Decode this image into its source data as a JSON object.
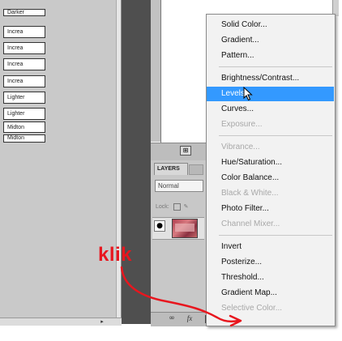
{
  "actions": {
    "rows": [
      "Darker",
      "Increa",
      "Increa",
      "Increa",
      "Increa",
      "Lighter",
      "Lighter",
      "Midton",
      "Midton"
    ]
  },
  "layers_panel": {
    "tab_label": "LAYERS",
    "blend_mode": "Normal",
    "lock_label": "Lock:"
  },
  "menu": {
    "items": [
      {
        "label": "Solid Color...",
        "state": "enabled"
      },
      {
        "label": "Gradient...",
        "state": "enabled"
      },
      {
        "label": "Pattern...",
        "state": "enabled"
      },
      {
        "label": "Brightness/Contrast...",
        "state": "enabled"
      },
      {
        "label": "Levels...",
        "state": "highlighted"
      },
      {
        "label": "Curves...",
        "state": "enabled"
      },
      {
        "label": "Exposure...",
        "state": "disabled"
      },
      {
        "label": "Vibrance...",
        "state": "disabled"
      },
      {
        "label": "Hue/Saturation...",
        "state": "enabled"
      },
      {
        "label": "Color Balance...",
        "state": "enabled"
      },
      {
        "label": "Black & White...",
        "state": "disabled"
      },
      {
        "label": "Photo Filter...",
        "state": "enabled"
      },
      {
        "label": "Channel Mixer...",
        "state": "disabled"
      },
      {
        "label": "Invert",
        "state": "enabled"
      },
      {
        "label": "Posterize...",
        "state": "enabled"
      },
      {
        "label": "Threshold...",
        "state": "enabled"
      },
      {
        "label": "Gradient Map...",
        "state": "enabled"
      },
      {
        "label": "Selective Color...",
        "state": "disabled"
      }
    ],
    "highlight_color": "#3399ff",
    "disabled_color": "#a8a8a8"
  },
  "annotation": {
    "label": "klik",
    "color": "#e8161e"
  },
  "icons": {
    "link": "link-icon",
    "fx": "fx-icon",
    "mask": "mask-icon",
    "adjustment": "adjustment-layer-icon",
    "group": "folder-icon",
    "new_layer": "new-layer-icon",
    "trash": "trash-icon",
    "eye": "eye-icon"
  }
}
